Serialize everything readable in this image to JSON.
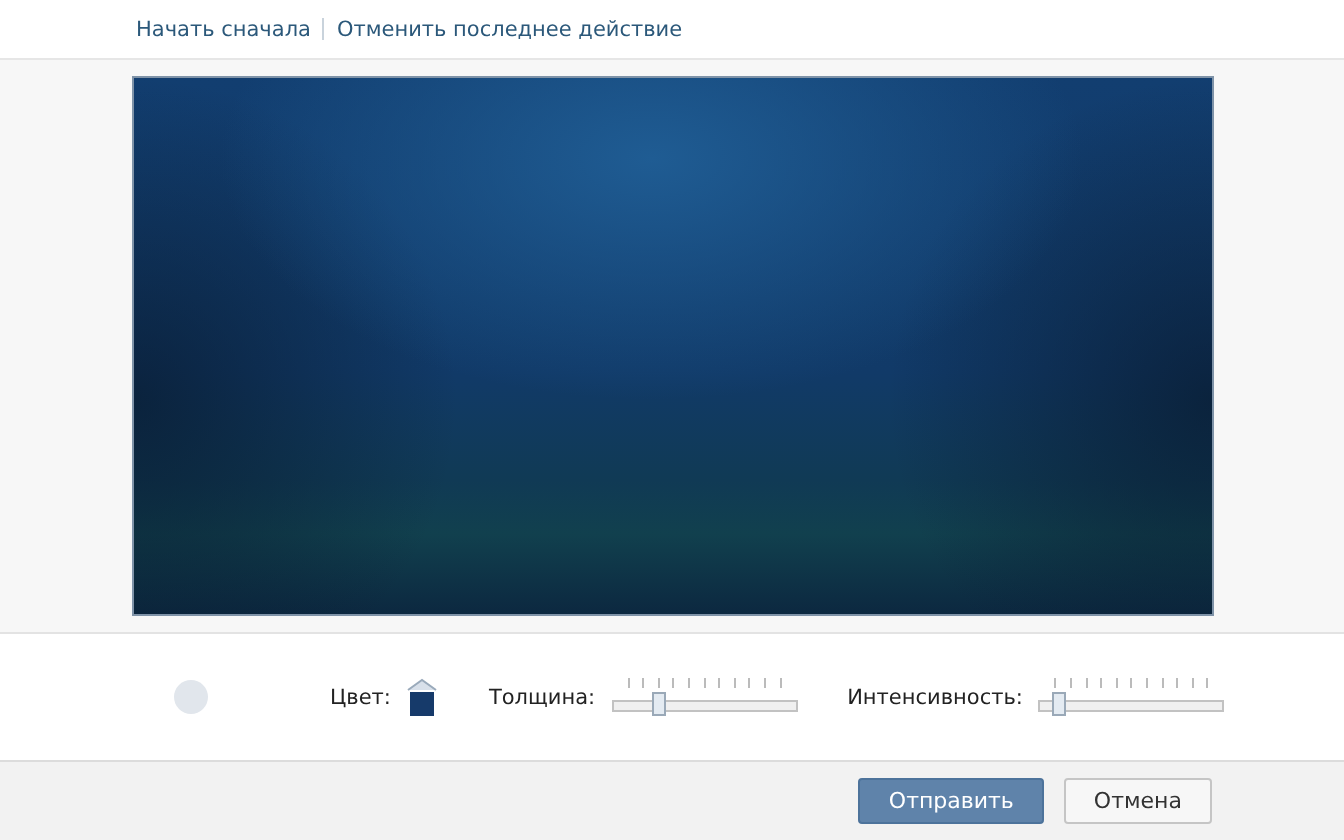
{
  "links": [
    {
      "label": "Начать сначала"
    },
    {
      "label": "Отменить последнее действие"
    }
  ],
  "toolbar": {
    "color": {
      "label": "Цвет:",
      "color": "#163a6a"
    },
    "sliders": [
      {
        "label": "Толщина:",
        "level": 0.25
      },
      {
        "label": "Интенсивность:",
        "level": 0.09
      }
    ]
  },
  "buttons": [
    {
      "label": "Отправить",
      "kind": "primary"
    },
    {
      "label": "Отмена",
      "kind": "secondary"
    }
  ]
}
